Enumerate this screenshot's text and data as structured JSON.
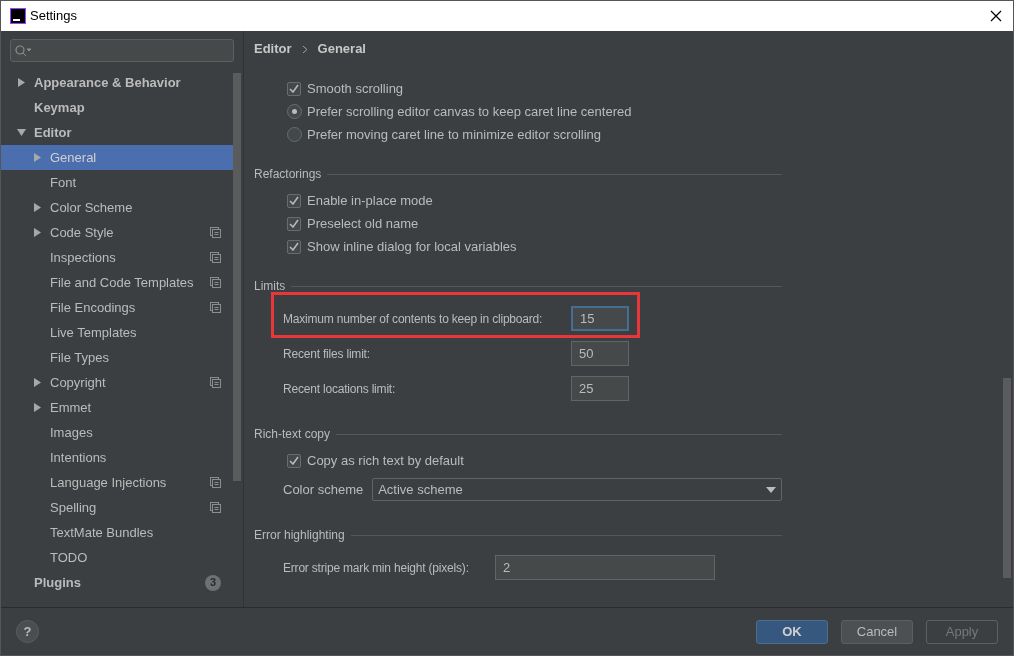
{
  "window": {
    "title": "Settings"
  },
  "help": "?",
  "sidebar": {
    "items": [
      {
        "label": "Appearance & Behavior",
        "expanded": false,
        "selected": false
      },
      {
        "label": "Keymap",
        "selected": false
      },
      {
        "label": "Editor",
        "expanded": true,
        "selected": false,
        "children": [
          {
            "label": "General",
            "expanded": false,
            "selected": true,
            "project_scoped": false
          },
          {
            "label": "Font",
            "selected": false,
            "project_scoped": false
          },
          {
            "label": "Color Scheme",
            "expanded": false,
            "selected": false,
            "project_scoped": false
          },
          {
            "label": "Code Style",
            "expanded": false,
            "selected": false,
            "project_scoped": true
          },
          {
            "label": "Inspections",
            "selected": false,
            "project_scoped": true
          },
          {
            "label": "File and Code Templates",
            "selected": false,
            "project_scoped": true
          },
          {
            "label": "File Encodings",
            "selected": false,
            "project_scoped": true
          },
          {
            "label": "Live Templates",
            "selected": false,
            "project_scoped": false
          },
          {
            "label": "File Types",
            "selected": false,
            "project_scoped": false
          },
          {
            "label": "Copyright",
            "expanded": false,
            "selected": false,
            "project_scoped": true
          },
          {
            "label": "Emmet",
            "expanded": false,
            "selected": false,
            "project_scoped": false
          },
          {
            "label": "Images",
            "selected": false,
            "project_scoped": false
          },
          {
            "label": "Intentions",
            "selected": false,
            "project_scoped": false
          },
          {
            "label": "Language Injections",
            "selected": false,
            "project_scoped": true
          },
          {
            "label": "Spelling",
            "selected": false,
            "project_scoped": true
          },
          {
            "label": "TextMate Bundles",
            "selected": false,
            "project_scoped": false
          },
          {
            "label": "TODO",
            "selected": false,
            "project_scoped": false
          }
        ]
      },
      {
        "label": "Plugins",
        "selected": false,
        "badge": "3"
      }
    ]
  },
  "breadcrumb": [
    "Editor",
    "General"
  ],
  "sections": [
    {
      "items": [
        {
          "kind": "checkbox",
          "label": "Smooth scrolling",
          "checked": true
        },
        {
          "kind": "radio",
          "label": "Prefer scrolling editor canvas to keep caret line centered",
          "selected": true
        },
        {
          "kind": "radio",
          "label": "Prefer moving caret line to minimize editor scrolling",
          "selected": false
        }
      ]
    },
    {
      "title": "Refactorings",
      "items": [
        {
          "kind": "checkbox",
          "label": "Enable in-place mode",
          "checked": true
        },
        {
          "kind": "checkbox",
          "label": "Preselect old name",
          "checked": true
        },
        {
          "kind": "checkbox",
          "label": "Show inline dialog for local variables",
          "checked": true
        }
      ]
    },
    {
      "title": "Limits",
      "items": [
        {
          "kind": "short_field",
          "label": "Maximum number of contents to keep in clipboard:",
          "value": "15",
          "focused": true,
          "highlighted": true
        },
        {
          "kind": "short_field",
          "label": "Recent files limit:",
          "value": "50",
          "focused": false,
          "highlighted": false
        },
        {
          "kind": "short_field",
          "label": "Recent locations limit:",
          "value": "25",
          "focused": false,
          "highlighted": false
        }
      ]
    },
    {
      "title": "Rich-text copy",
      "items": [
        {
          "kind": "checkbox",
          "label": "Copy as rich text by default",
          "checked": true
        },
        {
          "kind": "dropdown",
          "label": "Color scheme",
          "value": "Active scheme"
        }
      ]
    },
    {
      "title": "Error highlighting",
      "items": [
        {
          "kind": "wide_field",
          "label": "Error stripe mark min height (pixels):",
          "value": "2",
          "focused": false,
          "highlighted": false
        }
      ]
    }
  ],
  "buttons": [
    {
      "label": "OK",
      "kind": "primary",
      "disabled": false
    },
    {
      "label": "Cancel",
      "kind": "normal",
      "disabled": false
    },
    {
      "label": "Apply",
      "kind": "normal",
      "disabled": true
    }
  ]
}
